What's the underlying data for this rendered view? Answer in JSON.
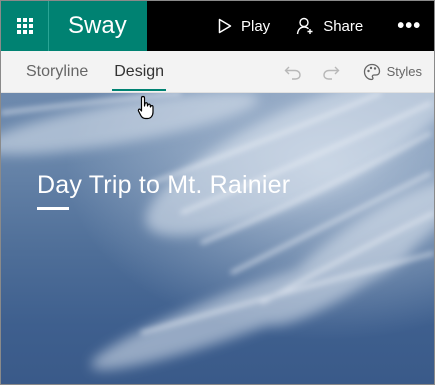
{
  "app": {
    "name": "Sway",
    "brand_color": "#008272"
  },
  "topbar": {
    "waffle_icon": "app-launcher-icon",
    "play_label": "Play",
    "share_label": "Share",
    "more_label": "•••"
  },
  "ribbon": {
    "tabs": [
      {
        "label": "Storyline",
        "active": false
      },
      {
        "label": "Design",
        "active": true
      }
    ],
    "undo_icon": "undo-icon",
    "redo_icon": "redo-icon",
    "styles_label": "Styles"
  },
  "canvas": {
    "title": "Day Trip to Mt. Rainier",
    "background": "sky-with-clouds"
  }
}
